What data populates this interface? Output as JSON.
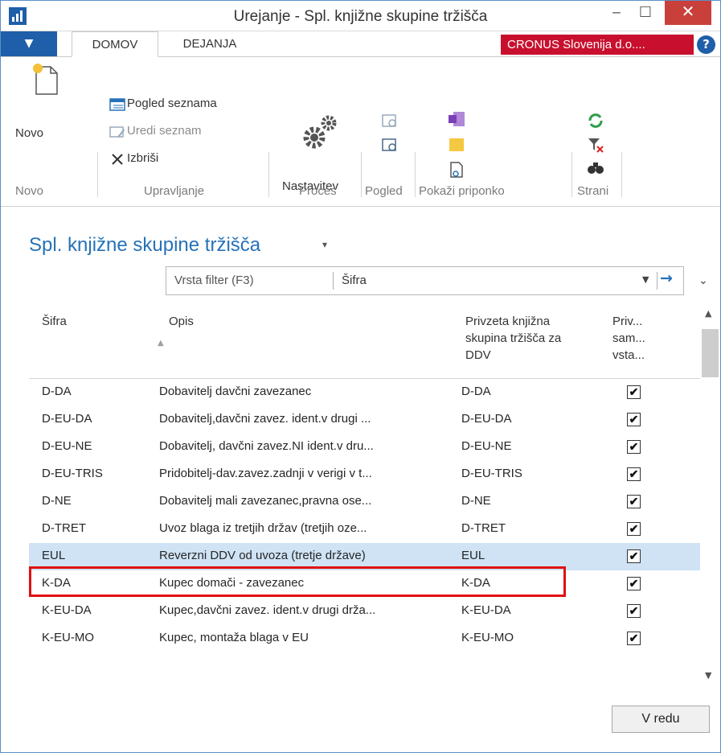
{
  "window": {
    "title": "Urejanje - Spl. knjižne skupine tržišča",
    "minimize": "‒",
    "maximize": "☐",
    "close": "✕"
  },
  "ribbon": {
    "file_tab": "▼",
    "tabs": [
      "DOMOV",
      "DEJANJA"
    ],
    "company": "CRONUS Slovenija d.o....",
    "help": "?",
    "new_label": "Novo",
    "list_view": "Pogled seznama",
    "edit_list": "Uredi seznam",
    "delete": "Izbriši",
    "setup": "Nastavitev",
    "groups": [
      "Novo",
      "Upravljanje",
      "Proces",
      "Pogled",
      "Pokaži priponko",
      "Strani"
    ]
  },
  "page": {
    "title": "Spl. knjižne skupine tržišča",
    "title_chevron": "▾"
  },
  "filter": {
    "placeholder": "Vrsta filter (F3)",
    "field": "Šifra",
    "dropdown": "▼",
    "go": "→",
    "collapse": "⌄"
  },
  "table": {
    "headers": {
      "code": "Šifra",
      "desc": "Opis",
      "grp_line1": "Privzeta knjižna",
      "grp_line2": "skupina tržišča za",
      "grp_line3": "DDV",
      "auto_line1": "Priv...",
      "auto_line2": "sam...",
      "auto_line3": "vsta..."
    },
    "sort_indicator": "▲",
    "rows": [
      {
        "code": "D-DA",
        "desc": "Dobavitelj davčni zavezanec",
        "grp": "D-DA",
        "checked": "✔"
      },
      {
        "code": "D-EU-DA",
        "desc": "Dobavitelj,davčni zavez. ident.v drugi ...",
        "grp": "D-EU-DA",
        "checked": "✔"
      },
      {
        "code": "D-EU-NE",
        "desc": "Dobavitelj, davčni zavez.NI ident.v dru...",
        "grp": "D-EU-NE",
        "checked": "✔"
      },
      {
        "code": "D-EU-TRIS",
        "desc": "Pridobitelj-dav.zavez.zadnji v verigi v t...",
        "grp": "D-EU-TRIS",
        "checked": "✔"
      },
      {
        "code": "D-NE",
        "desc": "Dobavitelj mali zavezanec,pravna ose...",
        "grp": "D-NE",
        "checked": "✔"
      },
      {
        "code": "D-TRET",
        "desc": "Uvoz blaga iz tretjih držav (tretjih oze...",
        "grp": "D-TRET",
        "checked": "✔"
      },
      {
        "code": "EUL",
        "desc": "Reverzni DDV od uvoza (tretje države)",
        "grp": "EUL",
        "checked": "✔"
      },
      {
        "code": "K-DA",
        "desc": "Kupec domači - zavezanec",
        "grp": "K-DA",
        "checked": "✔"
      },
      {
        "code": "K-EU-DA",
        "desc": "Kupec,davčni zavez. ident.v drugi drža...",
        "grp": "K-EU-DA",
        "checked": "✔"
      },
      {
        "code": "K-EU-MO",
        "desc": "Kupec, montaža blaga v EU",
        "grp": "K-EU-MO",
        "checked": "✔"
      }
    ]
  },
  "scroll": {
    "up": "▲",
    "down": "▼"
  },
  "footer": {
    "ok": "V redu"
  },
  "colors": {
    "accent": "#2672b8",
    "company": "#c8102e",
    "selected_row": "#cfe3f5",
    "highlight_box": "#e01111"
  }
}
